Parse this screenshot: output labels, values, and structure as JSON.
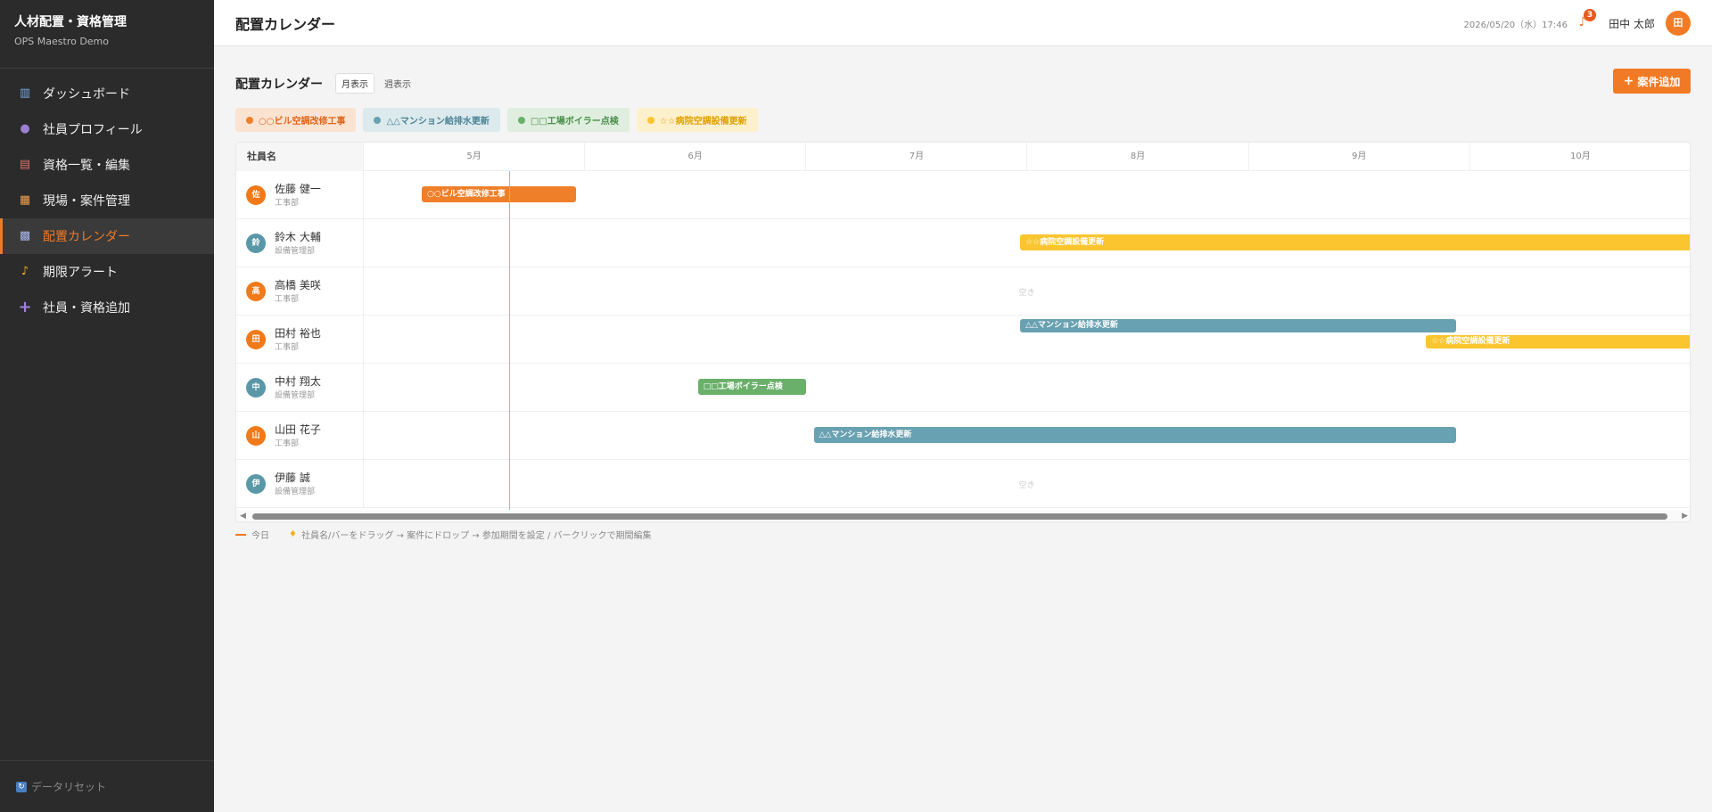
{
  "sidebar": {
    "brand_title": "人材配置・資格管理",
    "brand_sub": "OPS Maestro Demo",
    "items": [
      {
        "label": "ダッシュボード",
        "icon": "chart-icon"
      },
      {
        "label": "社員プロフィール",
        "icon": "person-icon"
      },
      {
        "label": "資格一覧・編集",
        "icon": "clipboard-icon"
      },
      {
        "label": "現場・案件管理",
        "icon": "building-icon"
      },
      {
        "label": "配置カレンダー",
        "icon": "calendar-icon"
      },
      {
        "label": "期限アラート",
        "icon": "bell-icon"
      },
      {
        "label": "社員・資格追加",
        "icon": "plus-icon"
      }
    ],
    "active_index": 4,
    "footer_label": "データリセット"
  },
  "header": {
    "title": "配置カレンダー",
    "datetime": "2026/05/20（水）17:46",
    "notification_count": "3",
    "user_name": "田中 太郎",
    "user_initial": "田"
  },
  "toolbar": {
    "section_title": "配置カレンダー",
    "view_month": "月表示",
    "view_week": "週表示",
    "add_label": "案件追加"
  },
  "projects": [
    {
      "name": "○○ビル空調改修工事",
      "color": "#f07f2a",
      "bg": "#fbe3d2",
      "text": "#e0661a"
    },
    {
      "name": "△△マンション給排水更新",
      "color": "#68a1b1",
      "bg": "#dce9ed",
      "text": "#4b8496"
    },
    {
      "name": "□□工場ボイラー点検",
      "color": "#6ab06a",
      "bg": "#dfeedf",
      "text": "#4a8f4a"
    },
    {
      "name": "☆☆病院空調設備更新",
      "color": "#fbc530",
      "bg": "#fdf0cc",
      "text": "#e0a000"
    }
  ],
  "calendar": {
    "name_header": "社員名",
    "months": [
      "5月",
      "6月",
      "7月",
      "8月",
      "9月",
      "10月"
    ],
    "empty_label": "空き",
    "employees": [
      {
        "name": "佐藤 健一",
        "dept": "工事部",
        "initial": "佐",
        "color": "#f07a1a",
        "bars": [
          {
            "project": 0,
            "label": "○○ビル空調改修工事",
            "start": 0.262,
            "end": 0.96
          }
        ]
      },
      {
        "name": "鈴木 大輔",
        "dept": "設備管理部",
        "initial": "鈴",
        "color": "#5a98a8",
        "bars": [
          {
            "project": 3,
            "label": "☆☆病院空調設備更新",
            "start": 2.966,
            "end": 6.0
          }
        ]
      },
      {
        "name": "高橋 美咲",
        "dept": "工事部",
        "initial": "高",
        "color": "#f07a1a",
        "bars": []
      },
      {
        "name": "田村 裕也",
        "dept": "工事部",
        "initial": "田",
        "color": "#f07a1a",
        "bars": [
          {
            "project": 1,
            "label": "△△マンション給排水更新",
            "start": 2.966,
            "end": 4.935,
            "lane": 0
          },
          {
            "project": 3,
            "label": "☆☆病院空調設備更新",
            "start": 4.8,
            "end": 6.0,
            "lane": 1
          }
        ]
      },
      {
        "name": "中村 翔太",
        "dept": "設備管理部",
        "initial": "中",
        "color": "#5a98a8",
        "bars": [
          {
            "project": 2,
            "label": "□□工場ボイラー点検",
            "start": 1.51,
            "end": 2.0
          }
        ]
      },
      {
        "name": "山田 花子",
        "dept": "工事部",
        "initial": "山",
        "color": "#f07a1a",
        "bars": [
          {
            "project": 1,
            "label": "△△マンション給排水更新",
            "start": 2.033,
            "end": 4.935
          }
        ]
      },
      {
        "name": "伊藤 誠",
        "dept": "設備管理部",
        "initial": "伊",
        "color": "#5a98a8",
        "bars": []
      }
    ],
    "today_position": 0.656
  },
  "footnote": {
    "today_label": "今日",
    "hint": "社員名/バーをドラッグ → 案件にドロップ → 参加期間を設定 / バークリックで期間編集"
  }
}
